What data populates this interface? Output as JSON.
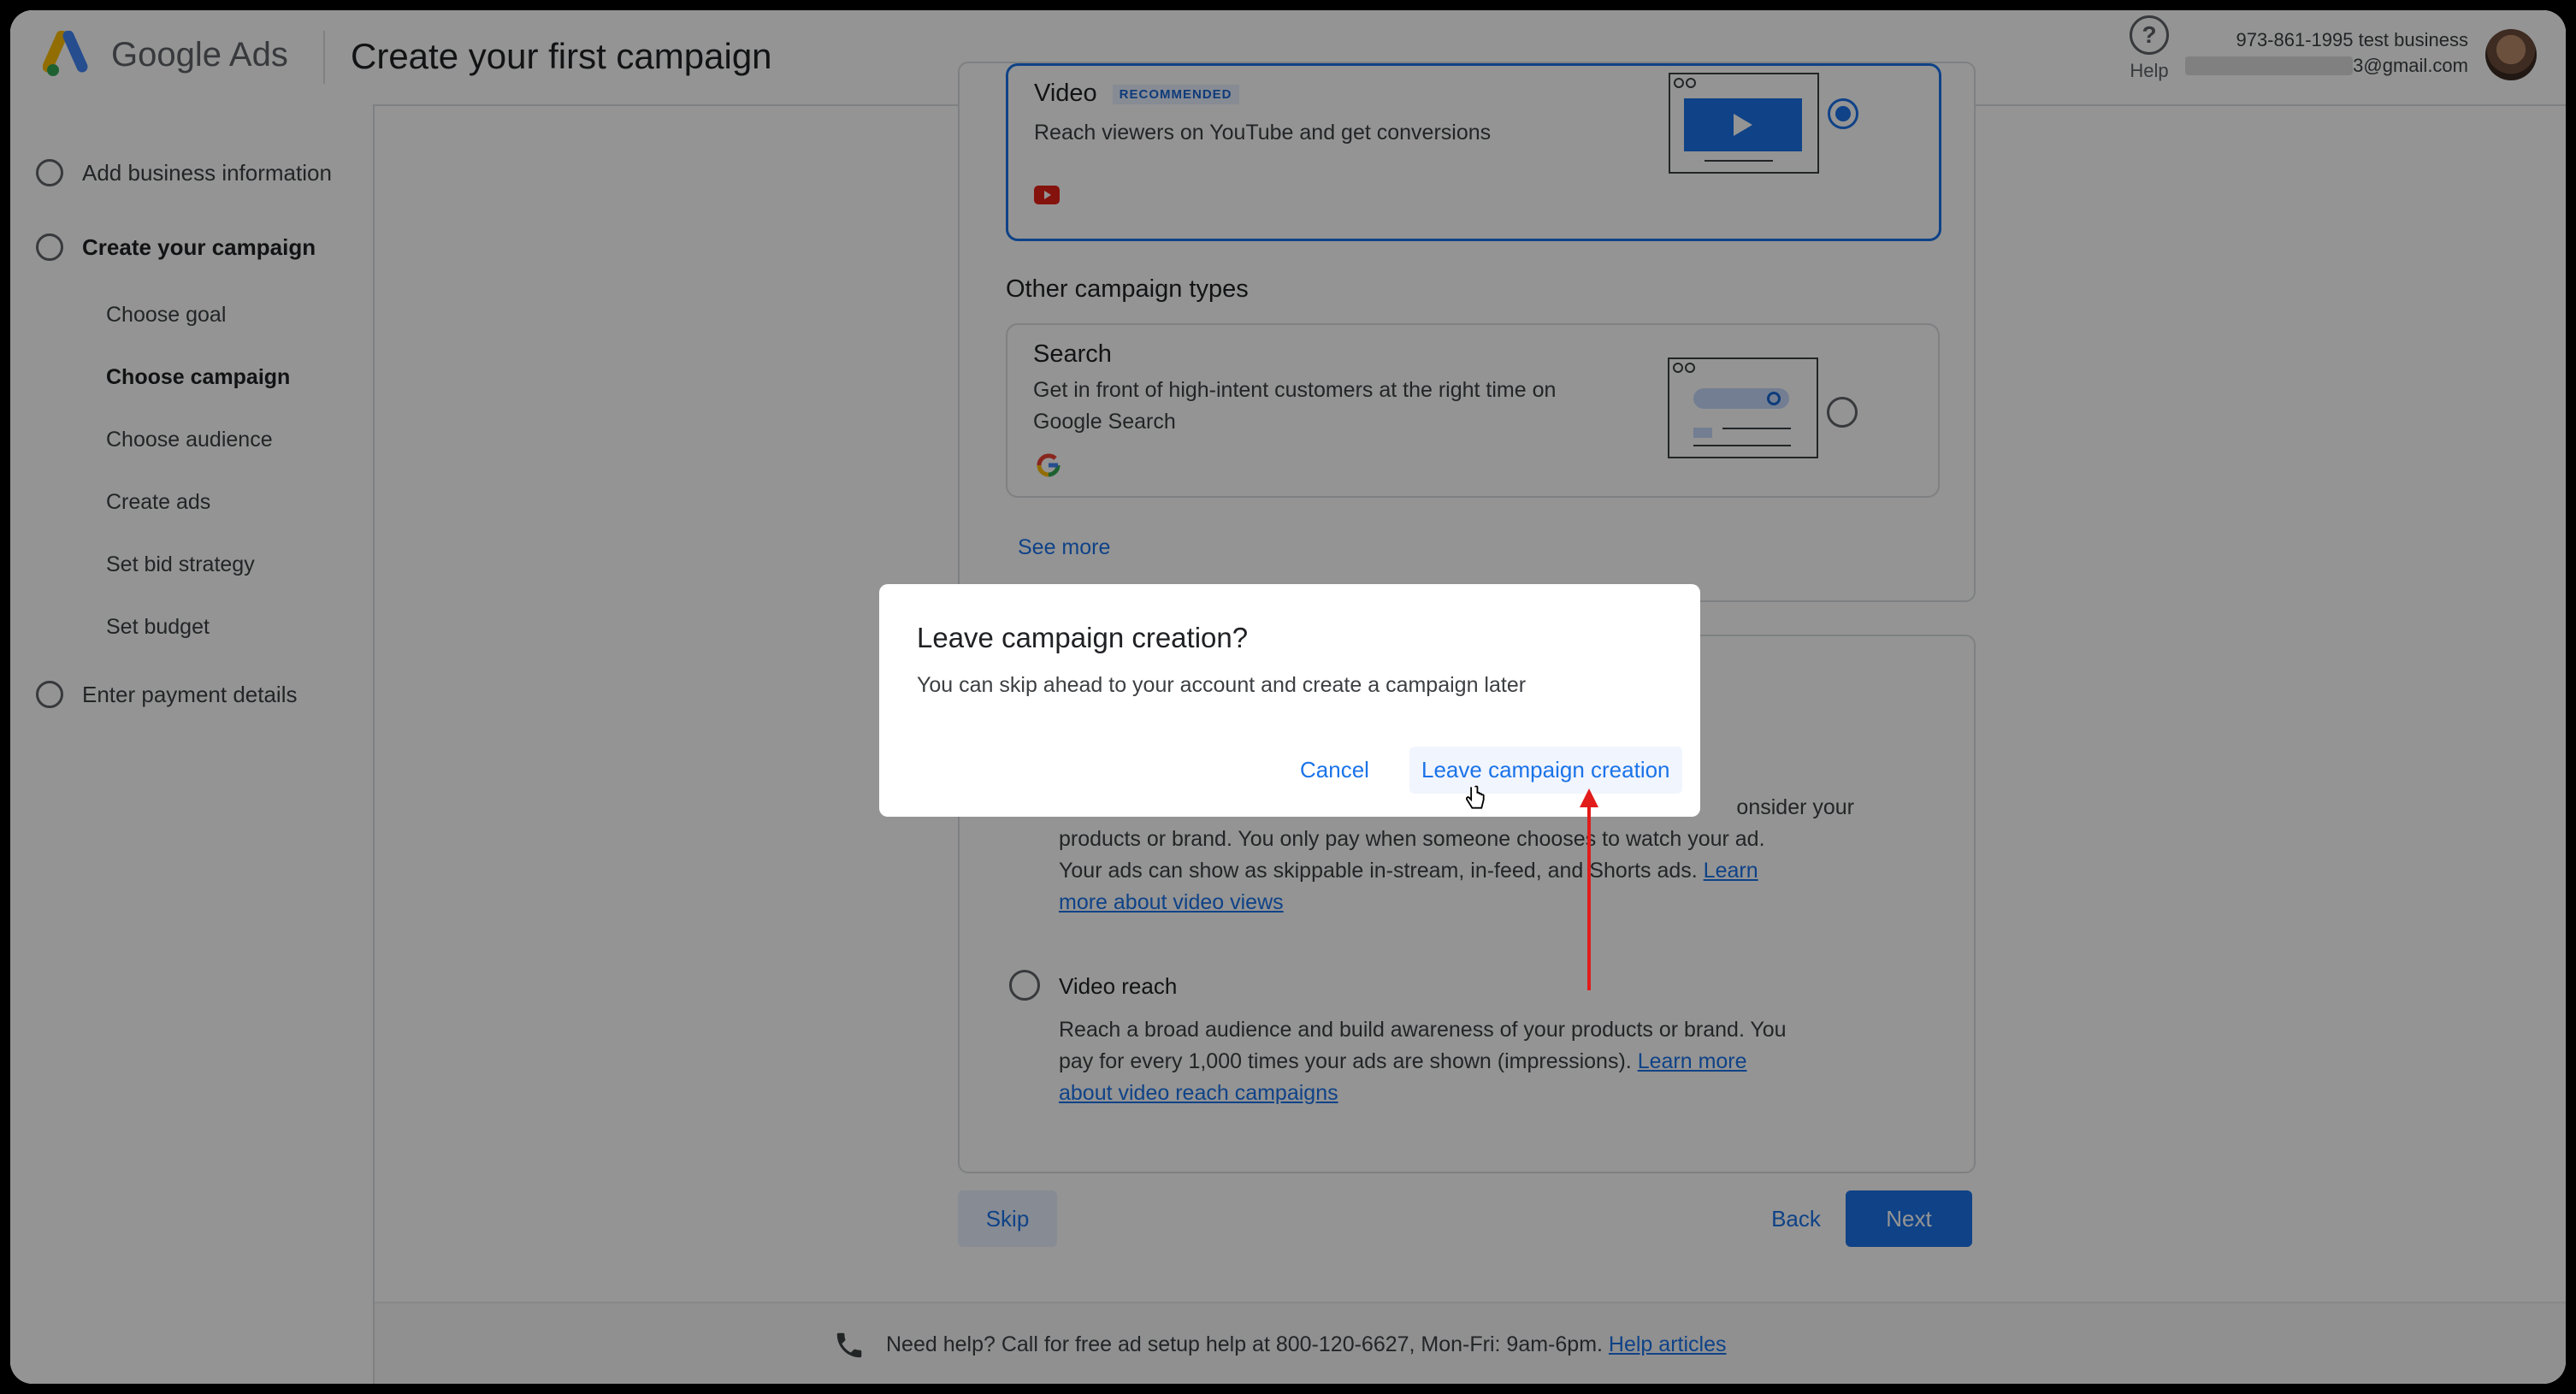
{
  "header": {
    "brand": "Google Ads",
    "title": "Create your first campaign",
    "help_label": "Help",
    "account_name": "973-861-1995 test business",
    "account_email_suffix": "3@gmail.com"
  },
  "sidebar": {
    "steps": [
      {
        "label": "Add business information"
      },
      {
        "label": "Create your campaign"
      },
      {
        "label": "Enter payment details"
      }
    ],
    "substeps": [
      {
        "label": "Choose goal"
      },
      {
        "label": "Choose campaign"
      },
      {
        "label": "Choose audience"
      },
      {
        "label": "Create ads"
      },
      {
        "label": "Set bid strategy"
      },
      {
        "label": "Set budget"
      }
    ]
  },
  "campaign": {
    "video": {
      "title": "Video",
      "badge": "RECOMMENDED",
      "description": "Reach viewers on YouTube and get conversions",
      "selected": true
    },
    "other_heading": "Other campaign types",
    "search": {
      "title": "Search",
      "description_line1": "Get in front of high-intent customers at the right time on",
      "description_line2": "Google Search",
      "selected": false
    },
    "see_more": "See more"
  },
  "subtype": {
    "views_line1_tail": "onsider your",
    "views_line2": "products or brand. You only pay when someone chooses to watch your ad.",
    "views_line3": "Your ads can show as skippable in-stream, in-feed, and Shorts ads.",
    "views_link_a": "Learn",
    "views_link_b": "more about video views",
    "reach_title": "Video reach",
    "reach_line1": "Reach a broad audience and build awareness of your products or brand. You",
    "reach_line2": "pay for every 1,000 times your ads are shown (impressions).",
    "reach_link_a": "Learn more",
    "reach_link_b": "about video reach campaigns"
  },
  "actions": {
    "skip": "Skip",
    "back": "Back",
    "next": "Next"
  },
  "footer": {
    "text": "Need help? Call for free ad setup help at 800-120-6627, Mon-Fri: 9am-6pm.",
    "link": "Help articles"
  },
  "dialog": {
    "title": "Leave campaign creation?",
    "text": "You can skip ahead to your account and create a campaign later",
    "cancel": "Cancel",
    "confirm": "Leave campaign creation"
  },
  "colors": {
    "accent": "#1a73e8",
    "annotation_arrow": "#e21b1b"
  }
}
